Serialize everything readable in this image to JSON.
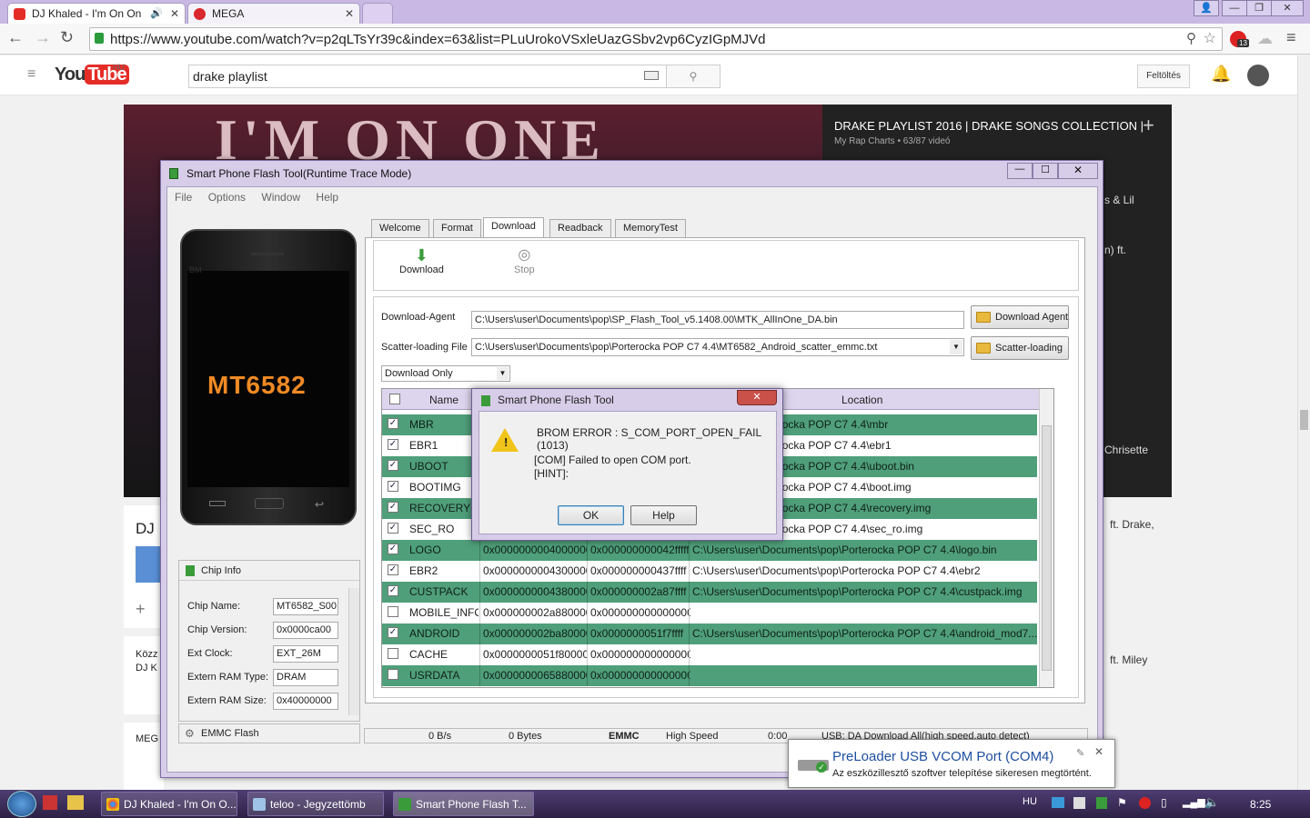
{
  "browser": {
    "tabs": [
      {
        "label": "DJ Khaled - I'm On On"
      },
      {
        "label": "MEGA"
      }
    ],
    "url": "https://www.youtube.com/watch?v=p2qLTsYr39c&index=63&list=PLuUrokoVSxleUazGSbv2vp6CyzIGpMJVd",
    "notification_badge": "13"
  },
  "youtube": {
    "logo": "YouTube",
    "region": "HU",
    "search_value": "drake playlist",
    "upload_label": "Feltöltés",
    "playlist_title": "DRAKE PLAYLIST 2016 | DRAKE SONGS COLLECTION |...",
    "playlist_meta": "My Rap Charts • 63/87 videó",
    "video_overlay_text": "I'M ON ONE",
    "side_items": [
      "s & Lil",
      "n) ft.",
      "Chrisette",
      "ft. Drake,",
      "ft. Miley"
    ],
    "left_fragments": [
      "DJ",
      "Közz",
      "DJ K",
      "MEG"
    ]
  },
  "flashtool": {
    "title": "Smart Phone Flash Tool(Runtime Trace Mode)",
    "menu": [
      "File",
      "Options",
      "Window",
      "Help"
    ],
    "phone_label": "MT6582",
    "phone_brand": "BM",
    "tabs": [
      "Welcome",
      "Format",
      "Download",
      "Readback",
      "MemoryTest"
    ],
    "actions": {
      "download": "Download",
      "stop": "Stop"
    },
    "download_agent_label": "Download-Agent",
    "download_agent_value": "C:\\Users\\user\\Documents\\pop\\SP_Flash_Tool_v5.1408.00\\MTK_AllInOne_DA.bin",
    "download_agent_button": "Download Agent",
    "scatter_label": "Scatter-loading File",
    "scatter_value": "C:\\Users\\user\\Documents\\pop\\Porterocka POP C7 4.4\\MT6582_Android_scatter_emmc.txt",
    "scatter_button": "Scatter-loading",
    "mode": "Download Only",
    "columns": {
      "name": "Name",
      "location": "Location"
    },
    "partitions": [
      {
        "name": "MBR",
        "begin": "",
        "end": "",
        "location": "uments\\pop\\Porterocka POP C7 4.4\\mbr",
        "checked": "✓"
      },
      {
        "name": "EBR1",
        "begin": "",
        "end": "",
        "location": "uments\\pop\\Porterocka POP C7 4.4\\ebr1",
        "checked": "✓"
      },
      {
        "name": "UBOOT",
        "begin": "",
        "end": "",
        "location": "uments\\pop\\Porterocka POP C7 4.4\\uboot.bin",
        "checked": "✓"
      },
      {
        "name": "BOOTIMG",
        "begin": "",
        "end": "",
        "location": "uments\\pop\\Porterocka POP C7 4.4\\boot.img",
        "checked": "✓"
      },
      {
        "name": "RECOVERY",
        "begin": "",
        "end": "",
        "location": "uments\\pop\\Porterocka POP C7 4.4\\recovery.img",
        "checked": "✓"
      },
      {
        "name": "SEC_RO",
        "begin": "",
        "end": "",
        "location": "uments\\pop\\Porterocka POP C7 4.4\\sec_ro.img",
        "checked": "✓"
      },
      {
        "name": "LOGO",
        "begin": "0x0000000004000000",
        "end": "0x000000000042fffff",
        "location": "C:\\Users\\user\\Documents\\pop\\Porterocka POP C7 4.4\\logo.bin",
        "checked": "✓"
      },
      {
        "name": "EBR2",
        "begin": "0x0000000004300000",
        "end": "0x000000000437ffff",
        "location": "C:\\Users\\user\\Documents\\pop\\Porterocka POP C7 4.4\\ebr2",
        "checked": "✓"
      },
      {
        "name": "CUSTPACK",
        "begin": "0x0000000004380000",
        "end": "0x000000002a87ffff",
        "location": "C:\\Users\\user\\Documents\\pop\\Porterocka POP C7 4.4\\custpack.img",
        "checked": "✓"
      },
      {
        "name": "MOBILE_INFO",
        "begin": "0x000000002a880000",
        "end": "0x0000000000000000",
        "location": "",
        "checked": ""
      },
      {
        "name": "ANDROID",
        "begin": "0x000000002ba80000",
        "end": "0x0000000051f7ffff",
        "location": "C:\\Users\\user\\Documents\\pop\\Porterocka POP C7 4.4\\android_mod7...",
        "checked": "✓"
      },
      {
        "name": "CACHE",
        "begin": "0x0000000051f80000",
        "end": "0x0000000000000000",
        "location": "",
        "checked": ""
      },
      {
        "name": "USRDATA",
        "begin": "0x0000000065880000",
        "end": "0x0000000000000000",
        "location": "",
        "checked": ""
      }
    ],
    "chip_info": {
      "header": "Chip Info",
      "rows": [
        {
          "label": "Chip Name:",
          "value": "MT6582_S00"
        },
        {
          "label": "Chip Version:",
          "value": "0x0000ca00"
        },
        {
          "label": "Ext Clock:",
          "value": "EXT_26M"
        },
        {
          "label": "Extern RAM Type:",
          "value": "DRAM"
        },
        {
          "label": "Extern RAM Size:",
          "value": "0x40000000"
        }
      ]
    },
    "emmc_label": "EMMC Flash",
    "status": {
      "speed": "0 B/s",
      "bytes": "0 Bytes",
      "storage": "EMMC",
      "usb": "High Speed",
      "time": "0:00",
      "message": "USB: DA Download All(high speed,auto detect)"
    }
  },
  "dialog": {
    "title": "Smart Phone Flash Tool",
    "error": "BROM ERROR : S_COM_PORT_OPEN_FAIL (1013)",
    "line1": "[COM] Failed to open COM port.",
    "line2": "[HINT]:",
    "ok": "OK",
    "help": "Help"
  },
  "toast": {
    "title": "PreLoader USB VCOM Port (COM4)",
    "body": "Az eszközillesztő szoftver telepítése sikeresen megtörtént."
  },
  "taskbar": {
    "items": [
      "DJ Khaled - I'm On O...",
      "teloo - Jegyzettömb",
      "Smart Phone Flash T..."
    ],
    "lang": "HU",
    "clock": "8:25"
  }
}
